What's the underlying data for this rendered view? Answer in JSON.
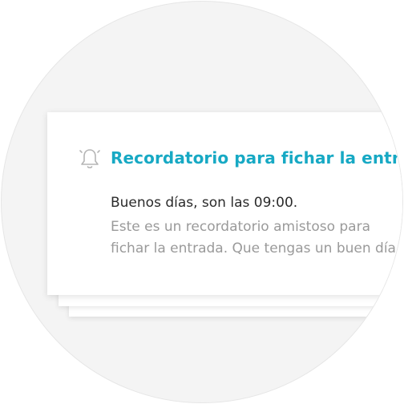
{
  "notification": {
    "icon": "bell-icon",
    "title": "Recordatorio para fichar la entrada",
    "greeting": "Buenos días, son las 09:00.",
    "body_line1": "Este es un recordatorio amistoso para",
    "body_line2": "fichar la entrada. Que tengas un buen día",
    "accent_color": "#17a9c4"
  }
}
